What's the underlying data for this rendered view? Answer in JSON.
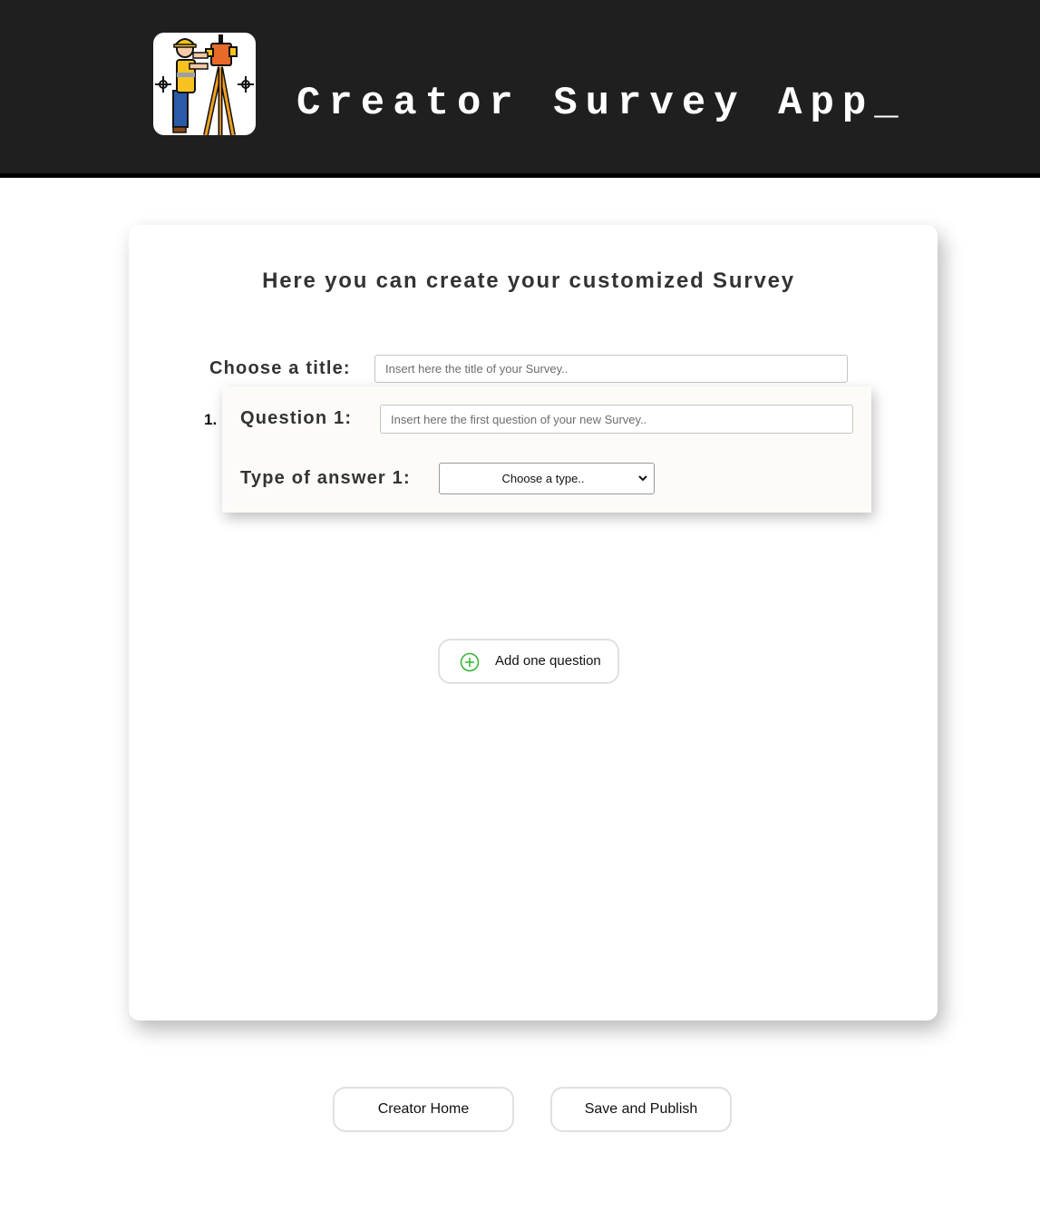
{
  "header": {
    "app_title": "Creator Survey App_",
    "logo_icon": "surveyor-icon",
    "background_color": "#1f1f1f"
  },
  "form": {
    "heading": "Here you can create your customized Survey",
    "title_label": "Choose a title:",
    "title_placeholder": "Insert here the title of your Survey..",
    "title_value": "",
    "questions": [
      {
        "number": "1.",
        "question_label": "Question 1:",
        "question_placeholder": "Insert here the first question of your new Survey..",
        "question_value": "",
        "answer_type_label": "Type of answer 1:",
        "answer_type_selected": "Choose a type.."
      }
    ],
    "add_question_label": "Add one question",
    "add_icon_color": "#2fb52f"
  },
  "footer": {
    "home_label": "Creator Home",
    "publish_label": "Save and Publish"
  }
}
